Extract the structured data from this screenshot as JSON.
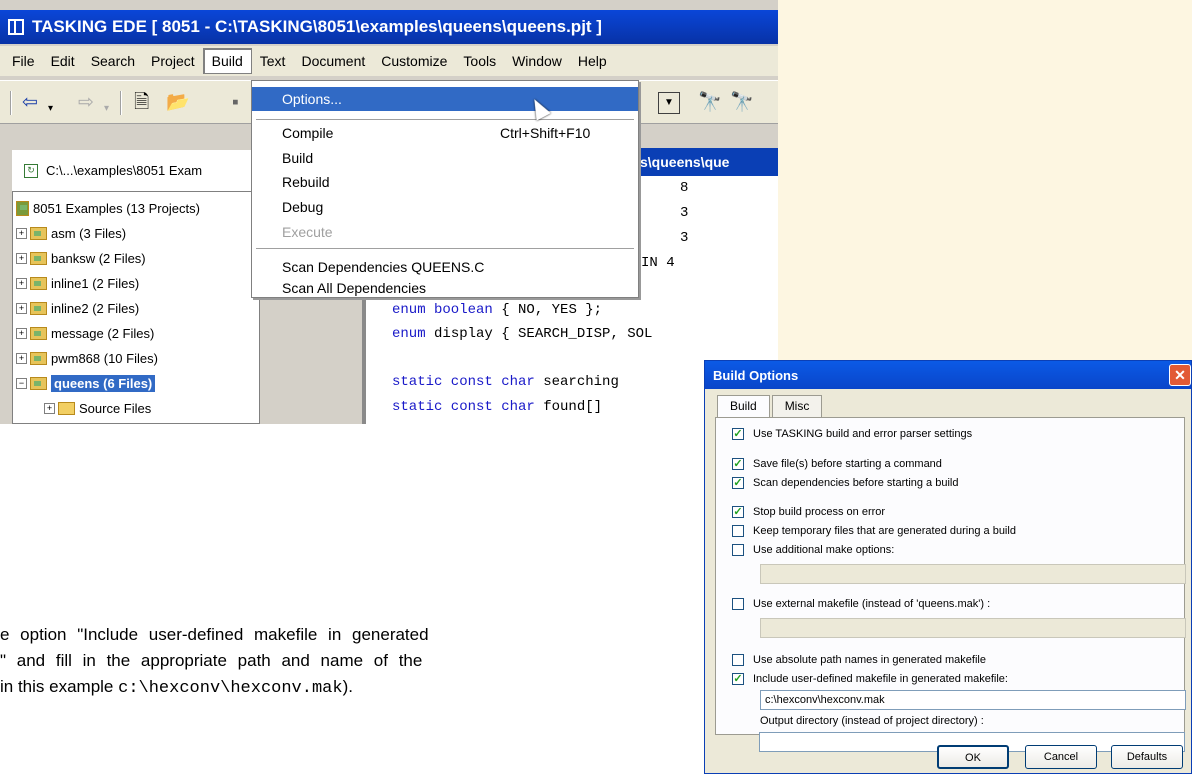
{
  "window": {
    "title": "TASKING EDE [ 8051 - C:\\TASKING\\8051\\examples\\queens\\queens.pjt ]"
  },
  "menubar": [
    "File",
    "Edit",
    "Search",
    "Project",
    "Build",
    "Text",
    "Document",
    "Customize",
    "Tools",
    "Window",
    "Help"
  ],
  "build_menu": {
    "options": "Options...",
    "compile": "Compile",
    "compile_shortcut": "Ctrl+Shift+F10",
    "build": "Build",
    "rebuild": "Rebuild",
    "debug": "Debug",
    "execute": "Execute",
    "scan_deps": "Scan Dependencies QUEENS.C",
    "scan_all": "Scan All Dependencies"
  },
  "tree": {
    "header": "C:\\...\\examples\\8051 Exam",
    "root": "8051 Examples (13 Projects)",
    "items": [
      "asm (3 Files)",
      "banksw (2 Files)",
      "inline1 (2 Files)",
      "inline2 (2 Files)",
      "message (2 Files)",
      "pwm868 (10 Files)",
      "queens (6 Files)",
      "Source Files"
    ]
  },
  "editor": {
    "tab_title": "s\\queens\\que",
    "nums": [
      "8",
      "3",
      "3"
    ],
    "in4": "IN 4",
    "line_bool_kw": "enum boolean",
    "line_bool_rest": " { NO, YES };",
    "line_disp_kw": "enum",
    "line_disp_rest": " display { SEARCH_DISP, SOL",
    "line_search_kw": "static const char",
    "line_search_rest": " searching",
    "line_found_kw": "static const char",
    "line_found_rest": " found[]"
  },
  "paragraph": {
    "line1": "e option \"Include user-defined makefile in generated",
    "line2": "\" and fill in the appropriate path and name of the",
    "line3_pre": "in this example ",
    "line3_code": "c:\\hexconv\\hexconv.mak",
    "line3_post": ")."
  },
  "dialog": {
    "title": "Build Options",
    "tabs": [
      "Build",
      "Misc"
    ],
    "options": [
      {
        "label": "Use TASKING build and error parser settings",
        "checked": true
      },
      {
        "label": "Save file(s) before starting a command",
        "checked": true
      },
      {
        "label": "Scan dependencies before starting a build",
        "checked": true
      },
      {
        "label": "Stop build process on error",
        "checked": true
      },
      {
        "label": "Keep temporary files that are generated during a build",
        "checked": false
      },
      {
        "label": "Use additional make options:",
        "checked": false
      },
      {
        "label": "Use external makefile (instead of 'queens.mak') :",
        "checked": false
      },
      {
        "label": "Use absolute path names in generated makefile",
        "checked": false
      },
      {
        "label": "Include user-defined makefile in generated makefile:",
        "checked": true
      }
    ],
    "makefile_value": "c:\\hexconv\\hexconv.mak",
    "output_dir_label": "Output directory (instead of project directory) :",
    "output_dir_value": "",
    "buttons": {
      "ok": "OK",
      "cancel": "Cancel",
      "defaults": "Defaults"
    }
  }
}
